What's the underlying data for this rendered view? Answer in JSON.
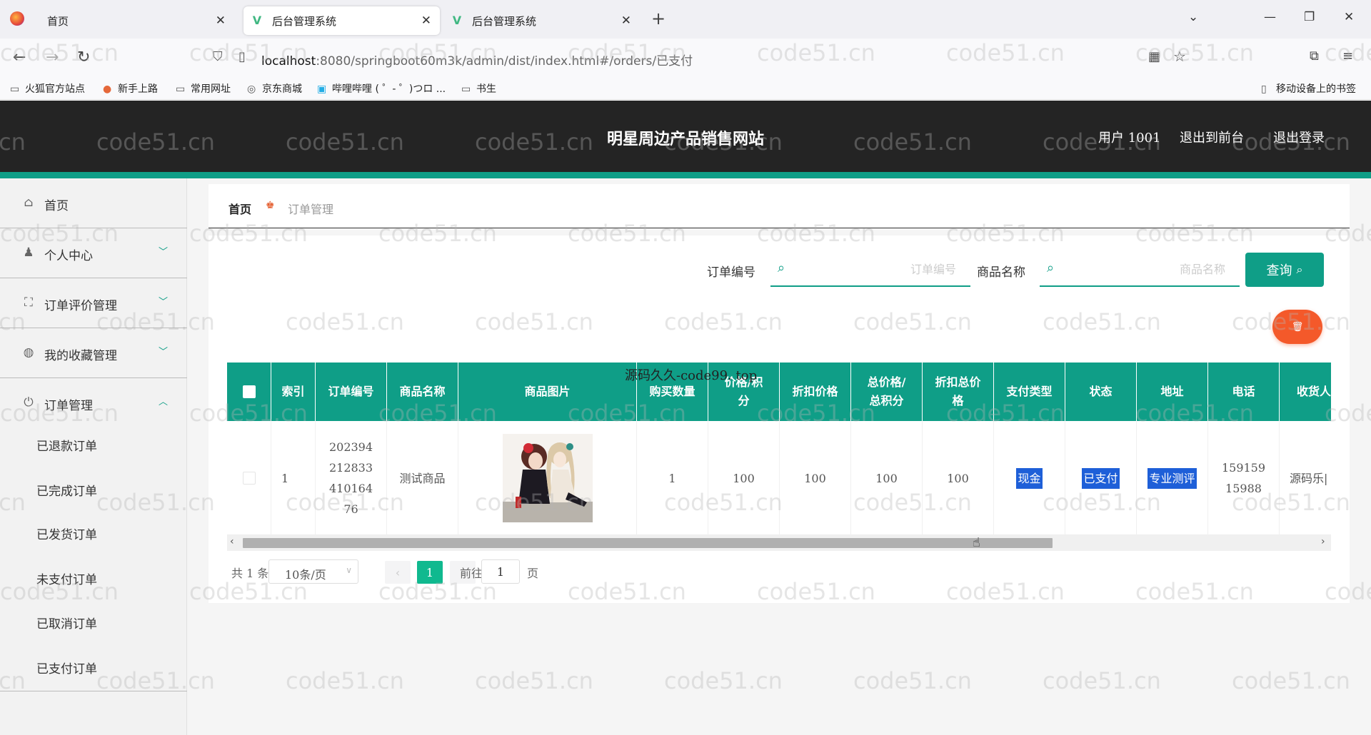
{
  "browser": {
    "tabs": [
      {
        "label": "首页"
      },
      {
        "label": "后台管理系统"
      },
      {
        "label": "后台管理系统"
      }
    ],
    "url_host": "localhost",
    "url_rest": ":8080/springboot60m3k/admin/dist/index.html#/orders/已支付",
    "bookmarks": [
      "火狐官方站点",
      "新手上路",
      "常用网址",
      "京东商城",
      "哔哩哔哩 ( ゜- ゜)つロ ...",
      "书生"
    ],
    "mobile_bookmarks": "移动设备上的书签"
  },
  "header": {
    "title": "明星周边产品销售网站",
    "user": "用户 1001",
    "to_front": "退出到前台",
    "logout": "退出登录"
  },
  "sidebar": {
    "items": [
      {
        "label": "首页",
        "icon": "home-icon"
      },
      {
        "label": "个人中心",
        "icon": "user-icon"
      },
      {
        "label": "订单评价管理",
        "icon": "fullscreen-icon"
      },
      {
        "label": "我的收藏管理",
        "icon": "globe-icon"
      },
      {
        "label": "订单管理",
        "icon": "power-icon"
      }
    ],
    "sub_items": [
      "已退款订单",
      "已完成订单",
      "已发货订单",
      "未支付订单",
      "已取消订单",
      "已支付订单"
    ]
  },
  "breadcrumb": {
    "home": "首页",
    "current": "订单管理"
  },
  "search": {
    "order_no_label": "订单编号",
    "order_no_placeholder": "订单编号",
    "product_label": "商品名称",
    "product_placeholder": "商品名称",
    "query_button": "查询"
  },
  "table": {
    "columns": [
      "索引",
      "订单编号",
      "商品名称",
      "商品图片",
      "购买数量",
      "价格/积分",
      "折扣价格",
      "总价格/总积分",
      "折扣总价格",
      "支付类型",
      "状态",
      "地址",
      "电话",
      "收货人"
    ],
    "rows": [
      {
        "index": "1",
        "order_no": "20239421283341016476",
        "product": "测试商品",
        "quantity": "100",
        "quantity_value": "1",
        "price": "100",
        "discount_price": "100",
        "total": "100",
        "discount_total": "100",
        "pay_type": "现金",
        "status": "已支付",
        "address": "专业测评",
        "phone": "15915915988",
        "receiver": "源码乐|"
      }
    ]
  },
  "pagination": {
    "total": "共 1 条",
    "page_size": "10条/页",
    "current_page": "1",
    "goto_prefix": "前往",
    "goto_value": "1",
    "goto_suffix": "页"
  },
  "overlay_text": "源码久久-code99. top",
  "watermark": "code51.cn",
  "colors": {
    "accent": "#0f9e87",
    "header_bg": "#242424",
    "danger": "#f4592a",
    "highlight": "#1e5fd8"
  }
}
